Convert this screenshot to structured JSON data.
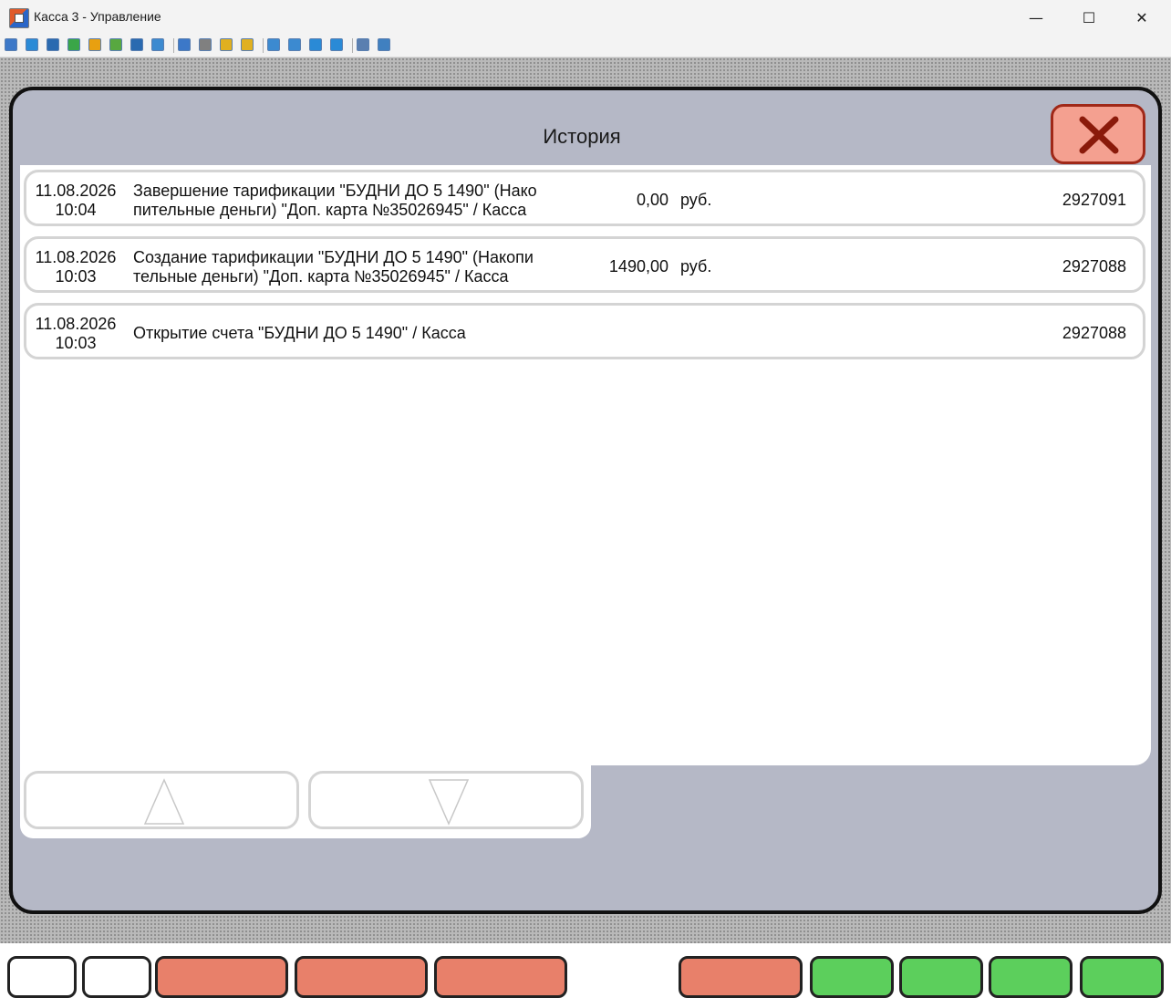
{
  "window": {
    "title": "Касса 3 - Управление",
    "minimize_glyph": "—",
    "maximize_glyph": "☐",
    "close_glyph": "✕"
  },
  "toolbar": {
    "icons": [
      {
        "name": "terminal-icon",
        "color": "#3c78c8"
      },
      {
        "name": "monitor-icon",
        "color": "#2a8ad6"
      },
      {
        "name": "console-icon",
        "color": "#2a6ab0"
      },
      {
        "name": "transfer-icon",
        "color": "#3aa648"
      },
      {
        "name": "clock-icon",
        "color": "#e8a010"
      },
      {
        "name": "chat-icon",
        "color": "#58a840"
      },
      {
        "name": "phone-icon",
        "color": "#2a6ab0"
      },
      {
        "name": "message-icon",
        "color": "#3c8ad0"
      },
      {
        "name": "user-upload-icon",
        "color": "#3c78c8"
      },
      {
        "name": "users-icon",
        "color": "#808080"
      },
      {
        "name": "lock-icon",
        "color": "#e0b020"
      },
      {
        "name": "lock-open-icon",
        "color": "#e0b020"
      },
      {
        "name": "window-icon",
        "color": "#3c8ad0"
      },
      {
        "name": "fullscreen-icon",
        "color": "#3c8ad0"
      },
      {
        "name": "square-icon",
        "color": "#2a8ad6"
      },
      {
        "name": "network-icon",
        "color": "#2a8ad6"
      },
      {
        "name": "copy-icon",
        "color": "#5a7fb0"
      },
      {
        "name": "tools-icon",
        "color": "#4080c0"
      }
    ]
  },
  "dialog": {
    "title": "История",
    "close_label": "close"
  },
  "history": [
    {
      "date": "11.08.2026",
      "time": "10:04",
      "desc_line1": "Завершение тарификации \"БУДНИ ДО 5 1490\" (Нако",
      "desc_line2": "пительные деньги) \"Доп. карта №35026945\" / Касса",
      "amount": "0,00",
      "currency": "руб.",
      "id": "2927091"
    },
    {
      "date": "11.08.2026",
      "time": "10:03",
      "desc_line1": "Создание тарификации \"БУДНИ ДО 5 1490\" (Накопи",
      "desc_line2": "тельные деньги) \"Доп. карта №35026945\" / Касса",
      "amount": "1490,00",
      "currency": "руб.",
      "id": "2927088"
    },
    {
      "date": "11.08.2026",
      "time": "10:03",
      "desc_line1": "Открытие счета \"БУДНИ ДО 5 1490\" / Касса",
      "desc_line2": "",
      "amount": "",
      "currency": "",
      "id": "2927088"
    }
  ],
  "nav": {
    "up": "scroll-up",
    "down": "scroll-down"
  },
  "colors": {
    "dialog_bg": "#b5b8c6",
    "close_bg": "#f4a090",
    "close_x": "#a02818"
  }
}
